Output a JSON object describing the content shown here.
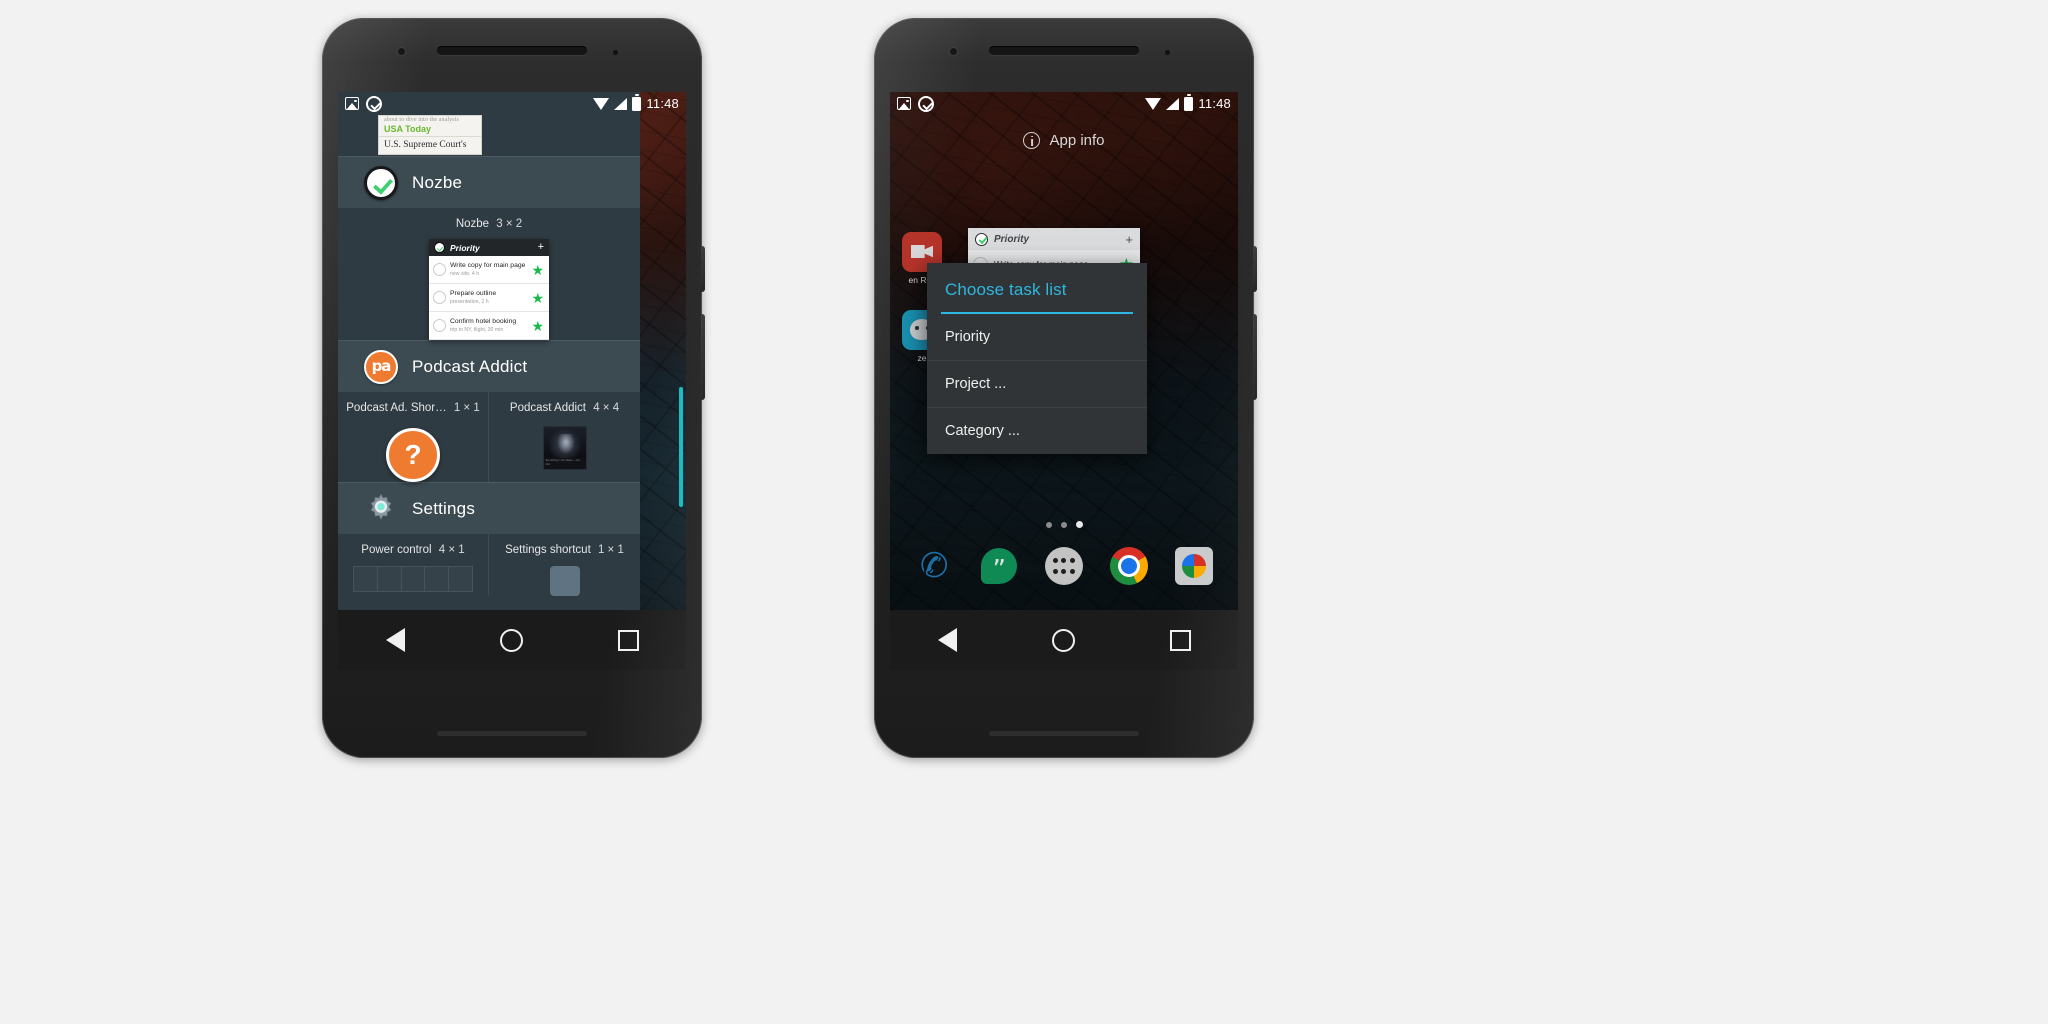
{
  "status_bar": {
    "time": "11:48",
    "icons": [
      "image-icon",
      "nozbe-notification-icon",
      "wifi-icon",
      "signal-icon",
      "battery-icon"
    ]
  },
  "left_phone": {
    "peek_card": {
      "line0": "about to dive into the analysis",
      "line1": "USA Today",
      "line2": "U.S. Supreme Court's"
    },
    "sections": [
      {
        "app": "Nozbe",
        "icon": "nozbe-icon",
        "widgets": [
          {
            "label": "Nozbe",
            "size": "3 × 2",
            "preview": {
              "header_title": "Priority",
              "add_label": "+",
              "tasks": [
                {
                  "title": "Write copy for main page",
                  "meta": "new site, 4 h",
                  "star": "★"
                },
                {
                  "title": "Prepare outline",
                  "meta": "presentation, 2 h",
                  "star": "★"
                },
                {
                  "title": "Confirm hotel booking",
                  "meta": "trip to NY, flight, 30 min",
                  "star": "★"
                }
              ]
            }
          }
        ]
      },
      {
        "app": "Podcast Addict",
        "icon": "podcast-addict-icon",
        "widgets": [
          {
            "label": "Podcast Ad. Shor…",
            "size": "1 × 1",
            "preview_glyph": "?"
          },
          {
            "label": "Podcast Addict",
            "size": "4 × 4",
            "thumb_caption": "Something in the Water — Ep. 214"
          }
        ]
      },
      {
        "app": "Settings",
        "icon": "settings-gear-icon",
        "widgets": [
          {
            "label": "Power control",
            "size": "4 × 1"
          },
          {
            "label": "Settings shortcut",
            "size": "1 × 1"
          }
        ]
      }
    ]
  },
  "right_phone": {
    "app_info_label": "App info",
    "app_info_icon": "info-icon",
    "placed_widget": {
      "header_title": "Priority",
      "add_label": "+",
      "task_title": "Write copy for main page",
      "star": "★"
    },
    "home_icons": [
      {
        "name": "screen-recorder-icon",
        "label": "en Rec"
      },
      {
        "name": "waze-icon",
        "label": "ze"
      }
    ],
    "dialog": {
      "title": "Choose task list",
      "accent_color": "#2cb7e0",
      "options": [
        "Priority",
        "Project ...",
        "Category ..."
      ]
    },
    "page_dots": {
      "count": 3,
      "active_index": 2
    },
    "dock": [
      {
        "name": "phone-icon",
        "glyph": "✆"
      },
      {
        "name": "hangouts-icon"
      },
      {
        "name": "app-drawer-icon"
      },
      {
        "name": "chrome-icon"
      },
      {
        "name": "camera-icon"
      }
    ]
  },
  "nav_bar": {
    "back": "back-button",
    "home": "home-button",
    "recents": "recents-button"
  }
}
